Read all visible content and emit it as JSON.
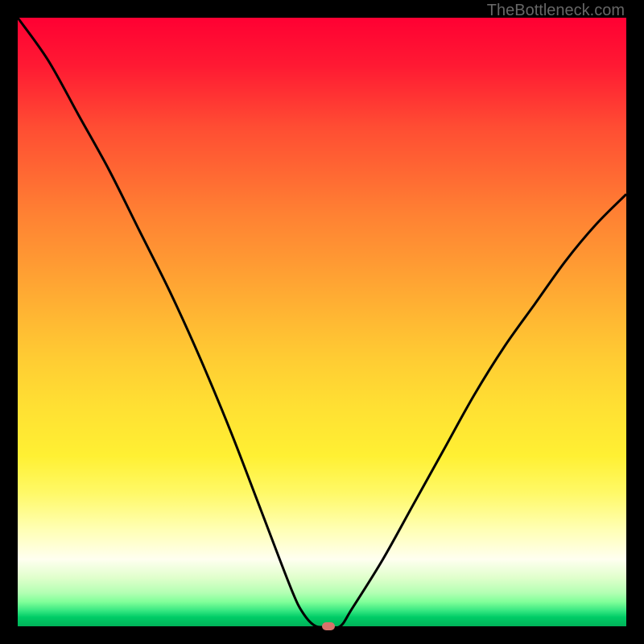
{
  "watermark": "TheBottleneck.com",
  "chart_data": {
    "type": "line",
    "title": "",
    "xlabel": "",
    "ylabel": "",
    "xlim": [
      0,
      100
    ],
    "ylim": [
      0,
      100
    ],
    "x": [
      0,
      5,
      10,
      15,
      20,
      25,
      30,
      35,
      40,
      45,
      47,
      49,
      51,
      53,
      55,
      60,
      65,
      70,
      75,
      80,
      85,
      90,
      95,
      100
    ],
    "values": [
      100,
      93,
      84,
      75,
      65,
      55,
      44,
      32,
      19,
      6,
      2,
      0,
      0,
      0,
      3,
      11,
      20,
      29,
      38,
      46,
      53,
      60,
      66,
      71
    ],
    "marker": {
      "x": 51,
      "y": 0
    },
    "gradient_stops": [
      {
        "pos": 0,
        "color": "#ff0033"
      },
      {
        "pos": 50,
        "color": "#ffcc33"
      },
      {
        "pos": 90,
        "color": "#ffffcc"
      },
      {
        "pos": 100,
        "color": "#00b359"
      }
    ]
  }
}
